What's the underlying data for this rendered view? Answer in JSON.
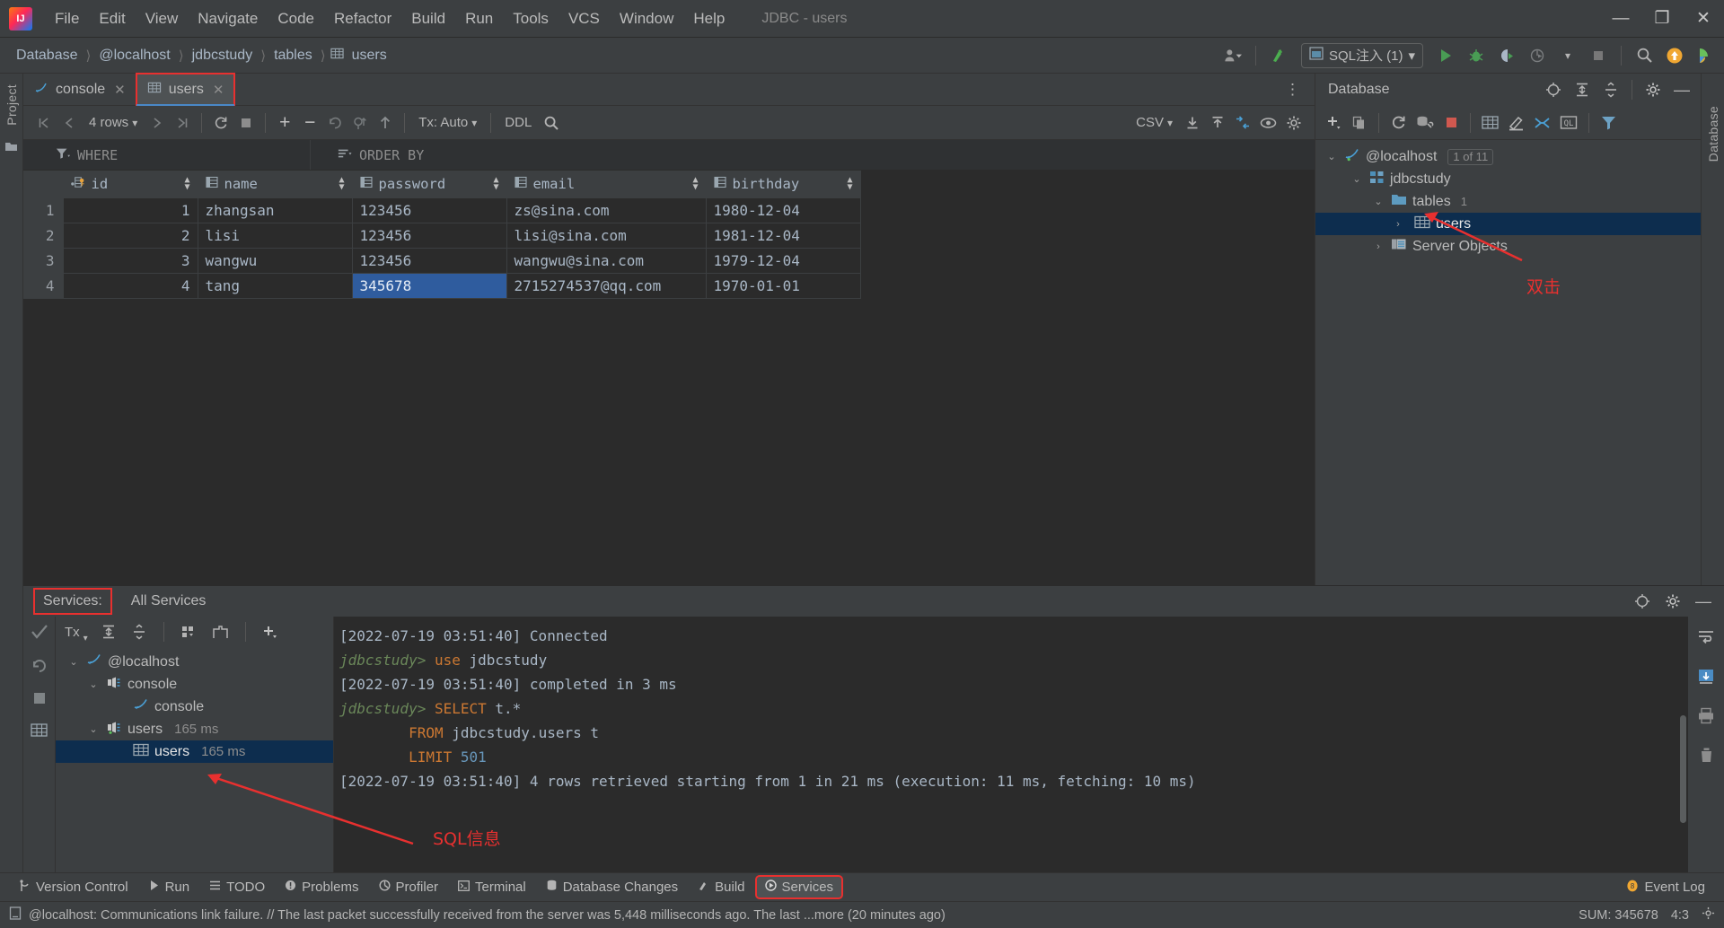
{
  "window": {
    "title": "JDBC - users",
    "logo_text": "IJ",
    "controls": {
      "minimize": "—",
      "maximize": "❐",
      "close": "✕"
    }
  },
  "menu": {
    "items": [
      "File",
      "Edit",
      "View",
      "Navigate",
      "Code",
      "Refactor",
      "Build",
      "Run",
      "Tools",
      "VCS",
      "Window",
      "Help"
    ]
  },
  "breadcrumb": {
    "items": [
      "Database",
      "@localhost",
      "jdbcstudy",
      "tables",
      "users"
    ],
    "separator": "〉",
    "last_icon": "table-icon"
  },
  "navbar_right": {
    "user_icon": "user-dropdown-icon",
    "hammer_icon": "build-icon",
    "sql_inject": {
      "label": "SQL注入 (1)",
      "caret": "▾",
      "icon": "sql-injection-icon"
    },
    "run_icon": "run-icon",
    "debug_icon": "debug-icon",
    "run_coverage_icon": "run-with-coverage-icon",
    "profile_icon": "profiler-icon",
    "stop_icon": "stop-icon",
    "search_icon": "search-everywhere-icon",
    "update_icon": "update-available-icon",
    "ide_icon": "ide-feature-icon"
  },
  "left_rail": {
    "label": "Project",
    "icons": [
      "folder-icon"
    ]
  },
  "right_rail": {
    "label": "Database"
  },
  "editor": {
    "tabs": [
      {
        "label": "console",
        "icon": "console-icon",
        "active": false,
        "close": "✕"
      },
      {
        "label": "users",
        "icon": "table-icon",
        "active": true,
        "close": "✕",
        "highlighted": true
      }
    ],
    "more_icon": "more-options-icon"
  },
  "grid_toolbar": {
    "first_page": "❘⟨",
    "prev_page": "⟨",
    "rows_label": "4 rows",
    "rows_caret": "⌄",
    "next_page": "⟩",
    "last_page": "⟩❘",
    "reload_icon": "refresh-icon",
    "stop_icon": "stop-icon",
    "add_row_icon": "+",
    "delete_row_icon": "−",
    "revert_icon": "revert-icon",
    "commit_key_icon": "commit-selected-icon",
    "submit_icon": "submit-icon",
    "tx_label": "Tx: Auto",
    "tx_caret": "⌄",
    "ddl_label": "DDL",
    "search_icon": "search-icon",
    "csv_label": "CSV",
    "csv_caret": "⌄",
    "import_icon": "import-icon",
    "export_icon": "export-icon",
    "compare_icon": "compare-icon",
    "view_icon": "value-viewer-icon",
    "settings_icon": "gear-icon"
  },
  "filters": {
    "where_label": "WHERE",
    "where_icon": "filter-icon",
    "order_label": "ORDER BY",
    "order_icon": "sort-icon"
  },
  "table": {
    "columns": [
      {
        "name": "id",
        "icon": "primary-key-icon",
        "sortable": true
      },
      {
        "name": "name",
        "icon": "column-icon",
        "sortable": true
      },
      {
        "name": "password",
        "icon": "column-icon",
        "sortable": true
      },
      {
        "name": "email",
        "icon": "column-icon",
        "sortable": true
      },
      {
        "name": "birthday",
        "icon": "column-icon",
        "sortable": true
      }
    ],
    "rows": [
      {
        "n": "1",
        "id": "1",
        "name": "zhangsan",
        "password": "123456",
        "email": "zs@sina.com",
        "birthday": "1980-12-04"
      },
      {
        "n": "2",
        "id": "2",
        "name": "lisi",
        "password": "123456",
        "email": "lisi@sina.com",
        "birthday": "1981-12-04"
      },
      {
        "n": "3",
        "id": "3",
        "name": "wangwu",
        "password": "123456",
        "email": "wangwu@sina.com",
        "birthday": "1979-12-04"
      },
      {
        "n": "4",
        "id": "4",
        "name": "tang",
        "password": "345678",
        "email": "2715274537@qq.com",
        "birthday": "1970-01-01"
      }
    ],
    "selected_cell": {
      "row": 4,
      "column": "password",
      "value": "345678"
    }
  },
  "db_panel": {
    "title": "Database",
    "head_icons": [
      "locate-icon",
      "expand-all-icon",
      "collapse-all-icon",
      "gear-icon",
      "hide-icon"
    ],
    "toolbar_icons": [
      "add-icon",
      "duplicate-icon",
      "refresh-icon",
      "data-source-properties-icon",
      "stop-icon",
      "table-editor-icon",
      "modify-icon",
      "jump-to-console-icon",
      "ql-icon",
      "filter-icon"
    ],
    "tree": [
      {
        "depth": 0,
        "label": "@localhost",
        "icon": "mysql-icon",
        "twist": "⌄",
        "badge": "1 of 11"
      },
      {
        "depth": 1,
        "label": "jdbcstudy",
        "icon": "schema-icon",
        "twist": "⌄"
      },
      {
        "depth": 2,
        "label": "tables",
        "icon": "folder-icon",
        "twist": "⌄",
        "count": "1"
      },
      {
        "depth": 3,
        "label": "users",
        "icon": "table-icon",
        "twist": "›",
        "selected": true,
        "highlighted": true
      },
      {
        "depth": 2,
        "label": "Server Objects",
        "icon": "server-objects-icon",
        "twist": "›"
      }
    ]
  },
  "annotations": [
    {
      "id": "double-click",
      "text": "双击"
    },
    {
      "id": "sql-info",
      "text": "SQL信息"
    }
  ],
  "services": {
    "tabs": [
      {
        "label": "Services:",
        "highlighted": true
      },
      {
        "label": "All Services",
        "highlighted": false
      }
    ],
    "head_icons": [
      "locate-icon",
      "gear-icon",
      "hide-icon"
    ],
    "left_icons": [
      "check-icon",
      "rerun-icon",
      "stop-icon",
      "grid-icon"
    ],
    "tree_toolbar": {
      "tx_label": "Tx",
      "icons": [
        "expand-all-icon",
        "collapse-all-icon",
        "group-icon",
        "new-tab-icon",
        "add-icon"
      ]
    },
    "tree": [
      {
        "depth": 0,
        "label": "@localhost",
        "icon": "mysql-icon",
        "twist": "⌄"
      },
      {
        "depth": 1,
        "label": "console",
        "icon": "session-icon",
        "twist": "⌄"
      },
      {
        "depth": 2,
        "label": "console",
        "icon": "console-icon",
        "twist": ""
      },
      {
        "depth": 1,
        "label": "users",
        "icon": "session-icon",
        "twist": "⌄",
        "time": "165 ms"
      },
      {
        "depth": 2,
        "label": "users",
        "icon": "table-icon",
        "twist": "",
        "time": "165 ms",
        "selected": true,
        "highlighted": true
      }
    ],
    "console_lines": [
      [
        {
          "t": "[2022-07-19 03:51:40] Connected",
          "c": "plain"
        }
      ],
      [
        {
          "t": "jdbcstudy> ",
          "c": "green"
        },
        {
          "t": "use ",
          "c": "kw"
        },
        {
          "t": "jdbcstudy",
          "c": "plain"
        }
      ],
      [
        {
          "t": "[2022-07-19 03:51:40] completed in 3 ms",
          "c": "plain"
        }
      ],
      [
        {
          "t": "jdbcstudy> ",
          "c": "green"
        },
        {
          "t": "SELECT ",
          "c": "kw"
        },
        {
          "t": "t.*",
          "c": "plain"
        }
      ],
      [
        {
          "t": "        ",
          "c": "plain"
        },
        {
          "t": "FROM ",
          "c": "kw"
        },
        {
          "t": "jdbcstudy.users t",
          "c": "plain"
        }
      ],
      [
        {
          "t": "        ",
          "c": "plain"
        },
        {
          "t": "LIMIT ",
          "c": "kw"
        },
        {
          "t": "501",
          "c": "num"
        }
      ],
      [
        {
          "t": "[2022-07-19 03:51:40] 4 rows retrieved starting from 1 in 21 ms (execution: 11 ms, fetching: 10 ms)",
          "c": "plain"
        }
      ]
    ],
    "right_icons": [
      "soft-wrap-icon",
      "scroll-to-end-icon",
      "print-icon",
      "delete-icon"
    ]
  },
  "toolwindow_bar": {
    "items": [
      {
        "label": "Version Control",
        "icon": "version-control-icon"
      },
      {
        "label": "Run",
        "icon": "run-icon"
      },
      {
        "label": "TODO",
        "icon": "todo-icon"
      },
      {
        "label": "Problems",
        "icon": "problems-icon"
      },
      {
        "label": "Profiler",
        "icon": "profiler-icon"
      },
      {
        "label": "Terminal",
        "icon": "terminal-icon"
      },
      {
        "label": "Database Changes",
        "icon": "database-changes-icon"
      },
      {
        "label": "Build",
        "icon": "build-icon"
      },
      {
        "label": "Services",
        "icon": "services-icon",
        "highlighted": true
      }
    ],
    "event_log": {
      "label": "Event Log",
      "icon": "event-log-icon"
    }
  },
  "statusbar": {
    "icon": "message-icon",
    "message": "@localhost: Communications link failure. // The last packet successfully received from the server was 5,448 milliseconds ago. The last  ...more (20 minutes ago)",
    "sum_label": "SUM: 345678",
    "position": "4:3",
    "right_icon": "gear-icon"
  },
  "colors": {
    "accent_red": "#e8302f",
    "selection_blue": "#2f5c9e",
    "tree_selection": "#0d2d4e",
    "panel_bg": "#3c3f41",
    "grid_bg": "#2b2b2b",
    "text": "#bbbbbb"
  }
}
